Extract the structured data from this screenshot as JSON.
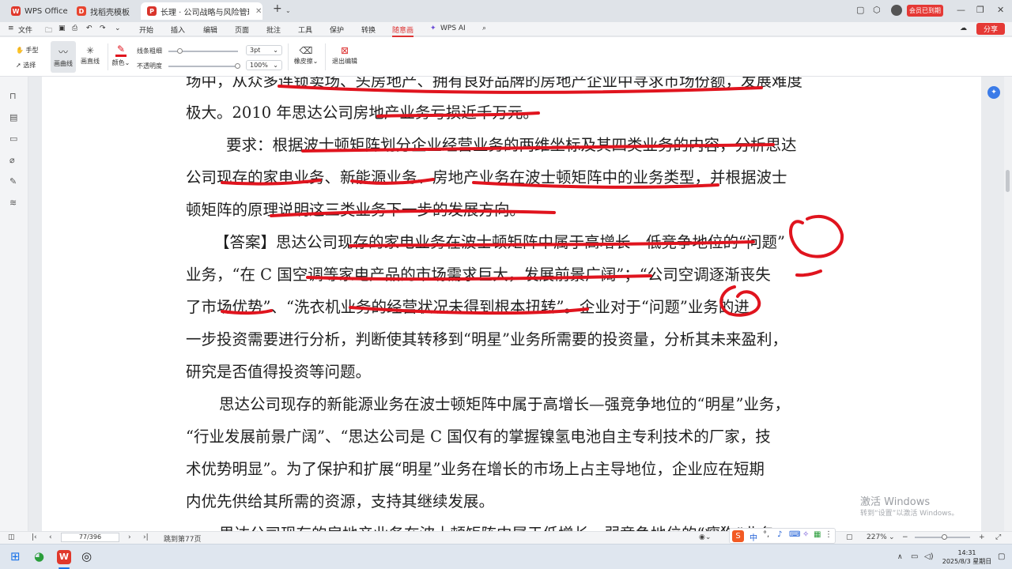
{
  "tabs": [
    {
      "label": "WPS Office",
      "icon": "wps-logo-icon"
    },
    {
      "label": "找稻壳模板",
      "icon": "docer-logo-icon"
    },
    {
      "label": "长理 · 公司战略与风险管理教",
      "icon": "pdf-logo-icon"
    }
  ],
  "titlebar": {
    "new_tab": "+",
    "member_label": "会员已到期"
  },
  "menu": {
    "file": "文件",
    "items": [
      "开始",
      "插入",
      "编辑",
      "页面",
      "批注",
      "工具",
      "保护",
      "转换",
      "随意画",
      "WPS AI"
    ],
    "active": "随意画",
    "share": "分享"
  },
  "ribbon": {
    "hand": "手型",
    "select": "选择",
    "curve": "画曲线",
    "line": "画直线",
    "color": "颜色",
    "thickness_label": "线条粗细",
    "thickness_value": "3pt",
    "opacity_label": "不透明度",
    "opacity_value": "100%",
    "eraser": "橡皮擦",
    "exit": "退出编辑"
  },
  "document": {
    "lines": [
      "场中，从众多连锁卖场、头房地产、拥有良好品牌的房地产企业中寻求市场份额，发展难度",
      "极大。2010 年思达公司房地产业务亏损近千万元。",
      "要求：根据波士顿矩阵划分企业经营业务的两维坐标及其四类业务的内容，分析思达",
      "公司现存的家电业务、新能源业务、房地产业务在波士顿矩阵中的业务类型，并根据波士",
      "顿矩阵的原理说明这三类业务下一步的发展方向。",
      "【答案】思达公司现存的家电业务在波士顿矩阵中属于高增长—低竞争地位的“问题”",
      "业务，“在 C 国空调等家电产品的市场需求巨大，发展前景广阔”；“公司空调逐渐丧失",
      "了市场优势”、“洗衣机业务的经营状况未得到根本扭转”。企业对于“问题”业务的进",
      "一步投资需要进行分析，判断使其转移到“明星”业务所需要的投资量，分析其未来盈利，",
      "研究是否值得投资等问题。",
      "思达公司现存的新能源业务在波士顿矩阵中属于高增长—强竞争地位的“明星”业务，",
      "“行业发展前景广阔”、“思达公司是 C 国仅有的掌握镍氢电池自主专利技术的厂家，技",
      "术优势明显”。为了保护和扩展“明星”业务在增长的市场上占主导地位，企业应在短期",
      "内优先供给其所需的资源，支持其继续发展。",
      "思达公司现存的房地产业务在波士顿矩阵中属于低增长—弱竞争地位的“瘦狗”业务，"
    ],
    "ink_color": "#e0141e"
  },
  "watermark": {
    "title": "激活 Windows",
    "subtitle": "转到“设置”以激活 Windows。"
  },
  "status": {
    "page_box": "77/396",
    "goto": "跳到第77页",
    "zoom": "227%"
  },
  "taskbar": {
    "time": "14:31",
    "date": "2025/8/3 星期日",
    "ime": "中"
  }
}
